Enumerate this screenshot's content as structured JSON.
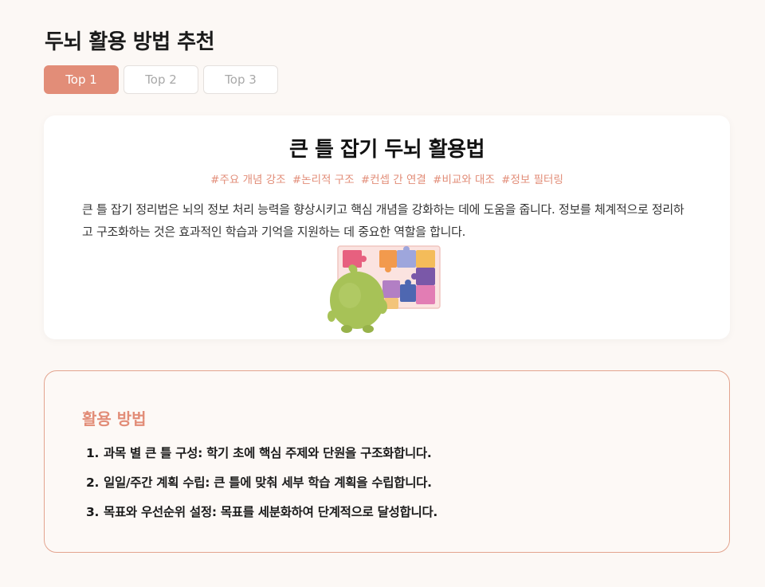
{
  "page": {
    "title": "두뇌 활용 방법 추천"
  },
  "tabs": [
    {
      "label": "Top 1",
      "active": true
    },
    {
      "label": "Top 2",
      "active": false
    },
    {
      "label": "Top 3",
      "active": false
    }
  ],
  "main_card": {
    "title": "큰 틀 잡기 두뇌 활용법",
    "hashtags": [
      "#주요 개념 강조",
      "#논리적 구조",
      "#컨셉 간 연결",
      "#비교와 대조",
      "#정보 필터링"
    ],
    "description": "큰 틀 잡기 정리법은 뇌의 정보 처리 능력을 향상시키고 핵심 개념을 강화하는 데에 도움을 줍니다. 정보를 체계적으로 정리하고 구조화하는 것은 효과적인 학습과 기억을 지원하는 데 중요한 역할을 합니다.",
    "illustration": "green-character-with-puzzle-board"
  },
  "usage": {
    "heading": "활용 방법",
    "items": [
      {
        "num": "1.",
        "text": "과목 별 큰 틀 구성: 학기 초에 핵심 주제와 단원을 구조화합니다."
      },
      {
        "num": "2.",
        "text": "일일/주간 계획 수립: 큰 틀에 맞춰 세부 학습 계획을 수립합니다."
      },
      {
        "num": "3.",
        "text": "목표와 우선순위 설정: 목표를 세분화하여 단계적으로 달성합니다."
      }
    ]
  },
  "colors": {
    "accent": "#e28d78",
    "background": "#fcf8f5",
    "card": "#ffffff",
    "usage_border": "#e3a48f"
  }
}
